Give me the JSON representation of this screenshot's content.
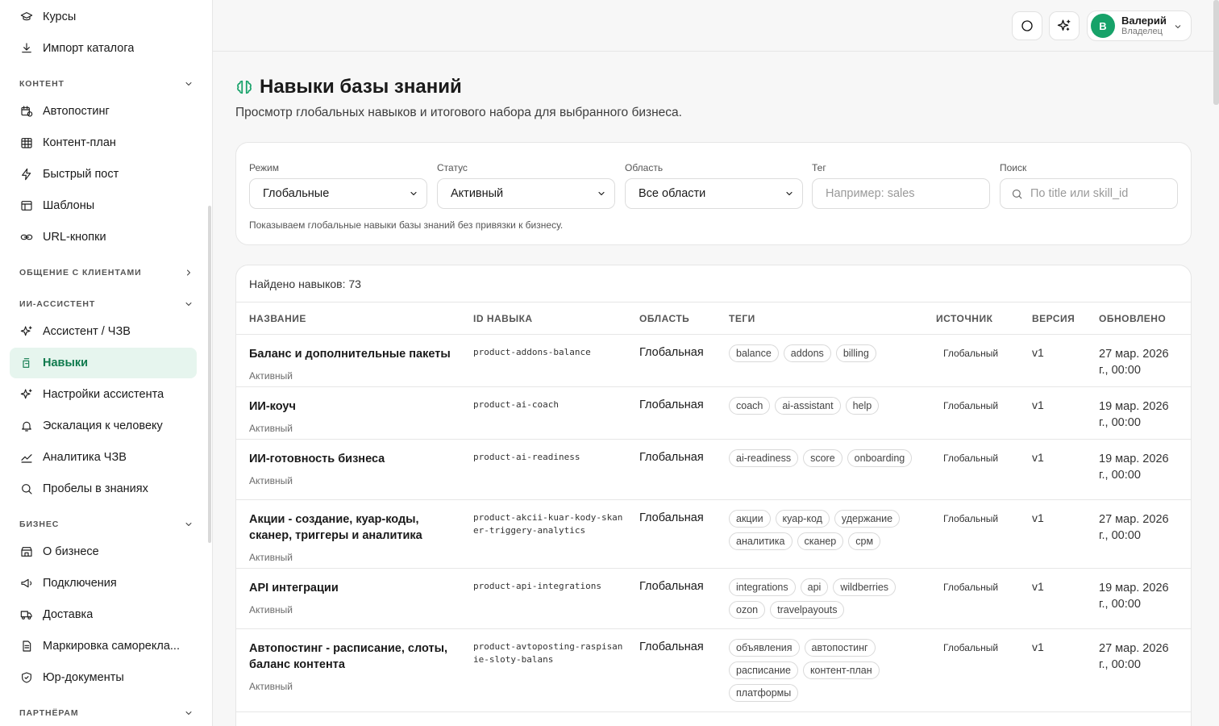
{
  "sidebar": {
    "items_top": [
      {
        "label": "Курсы",
        "icon": "graduation-cap-icon"
      },
      {
        "label": "Импорт каталога",
        "icon": "download-icon"
      }
    ],
    "sections": [
      {
        "title": "КОНТЕНТ",
        "expanded": true,
        "items": [
          {
            "label": "Автопостинг",
            "icon": "calendar-clock-icon"
          },
          {
            "label": "Контент-план",
            "icon": "calendar-grid-icon"
          },
          {
            "label": "Быстрый пост",
            "icon": "lightning-icon"
          },
          {
            "label": "Шаблоны",
            "icon": "layout-icon"
          },
          {
            "label": "URL-кнопки",
            "icon": "link-icon"
          }
        ]
      },
      {
        "title": "ОБЩЕНИЕ С КЛИЕНТАМИ",
        "expanded": false,
        "items": []
      },
      {
        "title": "ИИ-АССИСТЕНТ",
        "expanded": true,
        "items": [
          {
            "label": "Ассистент / ЧЗВ",
            "icon": "sparkles-icon"
          },
          {
            "label": "Навыки",
            "icon": "skill-icon",
            "active": true
          },
          {
            "label": "Настройки ассистента",
            "icon": "sparkles-icon"
          },
          {
            "label": "Эскалация к человеку",
            "icon": "bell-icon"
          },
          {
            "label": "Аналитика ЧЗВ",
            "icon": "trend-icon"
          },
          {
            "label": "Пробелы в знаниях",
            "icon": "search-icon"
          }
        ]
      },
      {
        "title": "БИЗНЕС",
        "expanded": true,
        "items": [
          {
            "label": "О бизнесе",
            "icon": "store-icon"
          },
          {
            "label": "Подключения",
            "icon": "megaphone-icon"
          },
          {
            "label": "Доставка",
            "icon": "truck-icon"
          },
          {
            "label": "Маркировка самореклa...",
            "icon": "document-icon"
          },
          {
            "label": "Юр-документы",
            "icon": "shield-icon"
          }
        ]
      },
      {
        "title": "ПАРТНЁРАМ",
        "expanded": true,
        "items": []
      }
    ]
  },
  "topbar": {
    "user_initial": "В",
    "user_name": "Валерий",
    "user_role": "Владелец"
  },
  "page": {
    "title": "Навыки базы знаний",
    "subtitle": "Просмотр глобальных навыков и итогового набора для выбранного бизнеса."
  },
  "filters": {
    "mode_label": "Режим",
    "mode_value": "Глобальные",
    "status_label": "Статус",
    "status_value": "Активный",
    "area_label": "Область",
    "area_value": "Все области",
    "tag_label": "Тег",
    "tag_placeholder": "Например: sales",
    "search_label": "Поиск",
    "search_placeholder": "По title или skill_id",
    "hint": "Показываем глобальные навыки базы знаний без привязки к бизнесу."
  },
  "table": {
    "found": "Найдено навыков: 73",
    "headers": {
      "name": "НАЗВАНИЕ",
      "id": "ID НАВЫКА",
      "area": "ОБЛАСТЬ",
      "tags": "ТЕГИ",
      "source": "ИСТОЧНИК",
      "version": "ВЕРСИЯ",
      "updated": "ОБНОВЛЕНО"
    },
    "rows": [
      {
        "name": "Баланс и дополнительные пакеты",
        "status": "Активный",
        "id": "product-addons-balance",
        "area": "Глобальная",
        "tags": [
          "balance",
          "addons",
          "billing"
        ],
        "source": "Глобальный",
        "version": "v1",
        "updated": "27 мар. 2026 г., 00:00"
      },
      {
        "name": "ИИ-коуч",
        "status": "Активный",
        "id": "product-ai-coach",
        "area": "Глобальная",
        "tags": [
          "coach",
          "ai-assistant",
          "help"
        ],
        "source": "Глобальный",
        "version": "v1",
        "updated": "19 мар. 2026 г., 00:00"
      },
      {
        "name": "ИИ-готовность бизнеса",
        "status": "Активный",
        "id": "product-ai-readiness",
        "area": "Глобальная",
        "tags": [
          "ai-readiness",
          "score",
          "onboarding"
        ],
        "source": "Глобальный",
        "version": "v1",
        "updated": "19 мар. 2026 г., 00:00"
      },
      {
        "name": "Акции - создание, куар-коды, сканер, триггеры и аналитика",
        "status": "Активный",
        "id": "product-akcii-kuar-kody-skaner-triggery-analytics",
        "area": "Глобальная",
        "tags": [
          "акции",
          "куар-код",
          "удержание",
          "аналитика",
          "сканер",
          "срм"
        ],
        "source": "Глобальный",
        "version": "v1",
        "updated": "27 мар. 2026 г., 00:00"
      },
      {
        "name": "API интеграции",
        "status": "Активный",
        "id": "product-api-integrations",
        "area": "Глобальная",
        "tags": [
          "integrations",
          "api",
          "wildberries",
          "ozon",
          "travelpayouts"
        ],
        "source": "Глобальный",
        "version": "v1",
        "updated": "19 мар. 2026 г., 00:00"
      },
      {
        "name": "Автопостинг - расписание, слоты, баланс контента",
        "status": "Активный",
        "id": "product-avtoposting-raspisanie-sloty-balans",
        "area": "Глобальная",
        "tags": [
          "объявления",
          "автопостинг",
          "расписание",
          "контент-план",
          "платформы"
        ],
        "source": "Глобальный",
        "version": "v1",
        "updated": "27 мар. 2026 г., 00:00"
      }
    ]
  }
}
